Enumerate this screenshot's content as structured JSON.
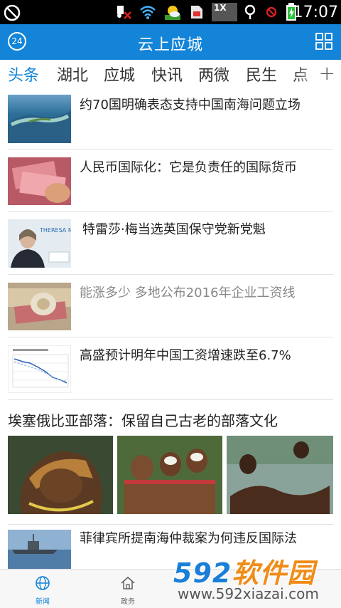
{
  "status_bar": {
    "time": "17:07",
    "network_badge": "1X",
    "icons": [
      "no-sim-icon",
      "muted-icon",
      "wifi-icon",
      "weather-app-icon",
      "sim-card-icon",
      "signal-icon",
      "no-signal-icon",
      "battery-charging-icon"
    ]
  },
  "header": {
    "title": "云上应城",
    "weather_badge": "24",
    "left_icon": "weather-icon",
    "right_icon": "grid-menu-icon"
  },
  "tabs": {
    "items": [
      "头条",
      "湖北",
      "应城",
      "快讯",
      "两微",
      "民生",
      "点"
    ],
    "active_index": 0,
    "add_icon": "+"
  },
  "news": [
    {
      "title": "约70国明确表态支持中国南海问题立场",
      "image": "island-aerial-photo",
      "read": false
    },
    {
      "title": "人民币国际化：它是负责任的国际货币",
      "image": "rmb-banknotes-photo",
      "read": false
    },
    {
      "title": "特雷莎·梅当选英国保守党新党魁",
      "image": "theresa-may-photo",
      "thumb_caption": "THERESA MA",
      "read": false
    },
    {
      "title": "能涨多少 多地公布2016年企业工资线",
      "image": "currency-photo",
      "read": true
    },
    {
      "title": "高盛预计明年中国工资增速跌至6.7%",
      "image": "wage-growth-chart-photo",
      "read": false
    }
  ],
  "gallery": {
    "title": "埃塞俄比亚部落：保留自己古老的部落文化",
    "images": [
      "tribal-portrait-photo",
      "painted-women-photo",
      "river-bathing-photo"
    ]
  },
  "last_news": {
    "title": "菲律宾所提南海仲裁案为何违反国际法",
    "image": "navy-ship-photo"
  },
  "bottom_nav": {
    "items": [
      {
        "label": "新闻",
        "icon": "globe-icon",
        "active": true
      },
      {
        "label": "政务",
        "icon": "home-icon",
        "active": false
      }
    ]
  },
  "watermark": {
    "brand": "592",
    "brand_cn": "软件园",
    "url": "www.592xiazai.com"
  },
  "colors": {
    "accent": "#1384d8",
    "status_bar": "#000000",
    "read_title": "#888888"
  }
}
